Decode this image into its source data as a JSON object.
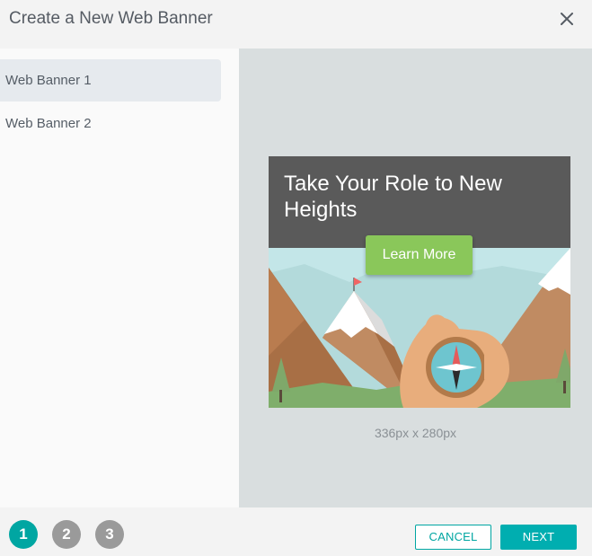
{
  "dialog": {
    "title": "Create a New Web Banner"
  },
  "sidebar": {
    "items": [
      {
        "label": "Web Banner 1",
        "selected": true
      },
      {
        "label": "Web Banner 2",
        "selected": false
      }
    ]
  },
  "preview": {
    "banner": {
      "heading": "Take Your Role to New Heights",
      "cta_label": "Learn More",
      "colors": {
        "header": "#5a5a5a",
        "cta": "#8ac75a",
        "sky": "#c3e6e8"
      }
    },
    "dimensions_label": "336px x 280px"
  },
  "footer": {
    "steps": [
      {
        "label": "1",
        "active": true
      },
      {
        "label": "2",
        "active": false
      },
      {
        "label": "3",
        "active": false
      }
    ],
    "cancel_label": "CANCEL",
    "next_label": "NEXT"
  },
  "theme": {
    "accent": "#00a6a2"
  }
}
